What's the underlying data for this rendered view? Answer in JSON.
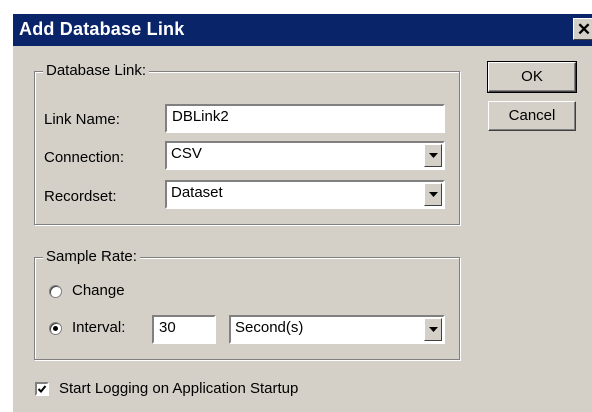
{
  "dialog": {
    "title": "Add Database Link",
    "close_glyph": "✕"
  },
  "buttons": {
    "ok": "OK",
    "cancel": "Cancel"
  },
  "database_link": {
    "legend": "Database Link:",
    "link_name_label": "Link Name:",
    "link_name_value": "DBLink2",
    "connection_label": "Connection:",
    "connection_value": "CSV",
    "recordset_label": "Recordset:",
    "recordset_value": "Dataset"
  },
  "sample_rate": {
    "legend": "Sample Rate:",
    "change_label": "Change",
    "change_selected": false,
    "interval_label": "Interval:",
    "interval_selected": true,
    "interval_value": "30",
    "unit_value": "Second(s)"
  },
  "start_logging": {
    "label": "Start Logging on Application Startup",
    "checked": true
  }
}
